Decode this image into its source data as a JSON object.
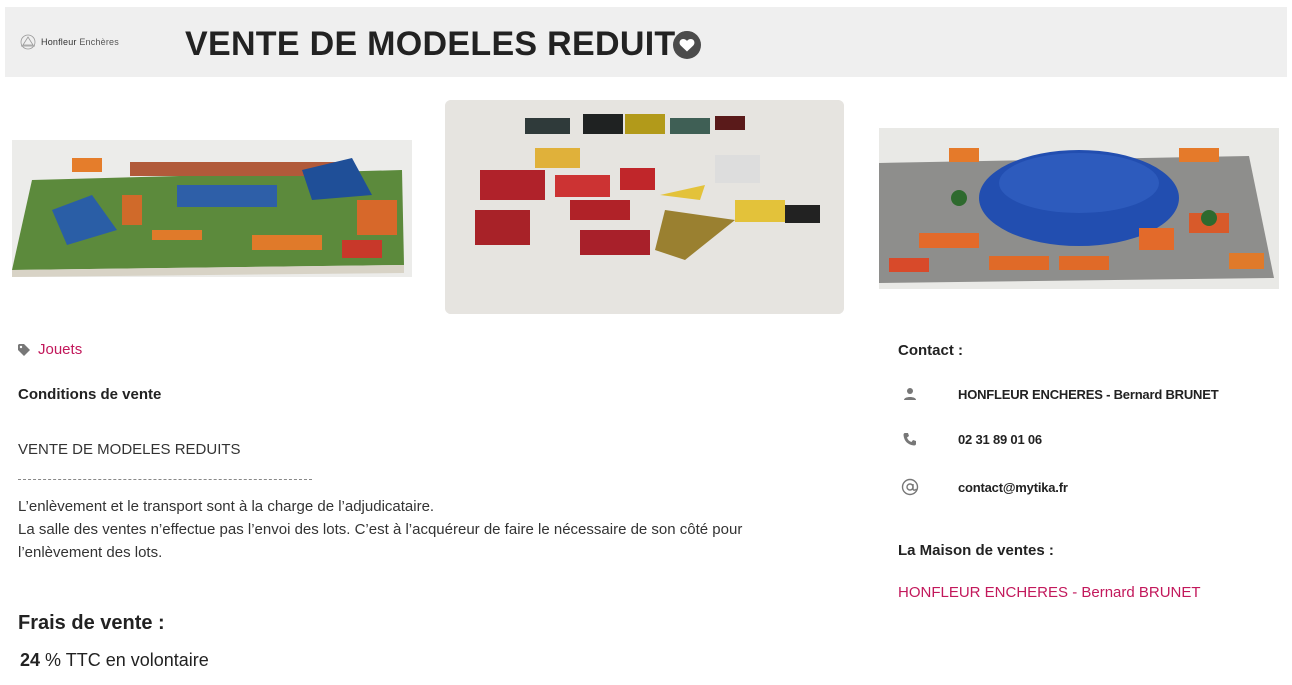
{
  "header": {
    "logo_text_1": "Honfleur",
    "logo_text_2": "Enchères",
    "title": "VENTE DE MODELES REDUITS"
  },
  "images": [
    {
      "alt": "Diorama cirque avec chapiteaux bleus"
    },
    {
      "alt": "Voitures et avions miniatures"
    },
    {
      "alt": "Diorama grand chapiteau bleu"
    }
  ],
  "category": {
    "label": "Jouets"
  },
  "conditions": {
    "title": "Conditions de vente",
    "sale_name": "VENTE DE MODELES REDUITS",
    "line1": "L’enlèvement et le transport sont à la charge de l’adjudicataire.",
    "line2": "La salle des ventes n’effectue pas l’envoi des lots. C’est à l’acquéreur de faire le nécessaire de son côté pour l’enlèvement des lots."
  },
  "fees": {
    "title": "Frais de vente :",
    "value": "24",
    "text": " % TTC en volontaire"
  },
  "contact": {
    "title": "Contact :",
    "name": "HONFLEUR ENCHERES - Bernard BRUNET",
    "phone": "02 31 89 01 06",
    "email": "contact@mytika.fr"
  },
  "maison": {
    "title": "La Maison de ventes :",
    "link": "HONFLEUR ENCHERES - Bernard BRUNET"
  },
  "colors": {
    "accent": "#c2185b",
    "header_bg": "#efefef"
  }
}
